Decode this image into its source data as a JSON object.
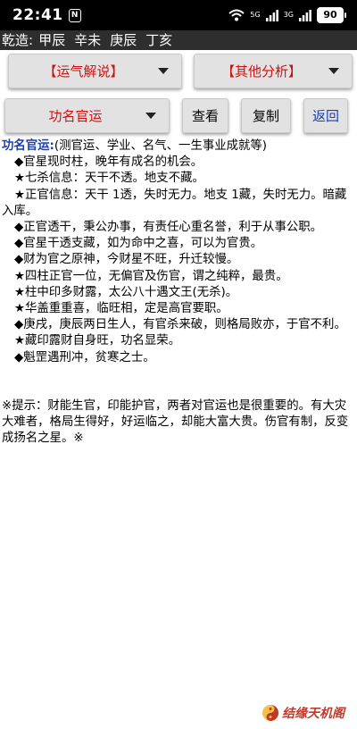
{
  "status_bar": {
    "time": "22:41",
    "n_badge": "N",
    "net_top": "5G",
    "net_bottom": "3G",
    "battery": "90"
  },
  "bazi": {
    "label": "乾造:",
    "pillars": [
      "甲辰",
      "辛未",
      "庚辰",
      "丁亥"
    ]
  },
  "controls": {
    "dropdown1": "【运气解说】",
    "dropdown2": "【其他分析】",
    "dropdown3": "功名官运",
    "view_button": "查看",
    "copy_button": "复制",
    "back_button": "返回"
  },
  "content": {
    "title": "功名官运:",
    "subtitle": "(测官运、学业、名气、一生事业成就等)",
    "lines": [
      "◆官星现时柱，晚年有成名的机会。",
      "★七杀信息：天干不透。地支不藏。",
      "★正官信息：天干 1透，失时无力。地支 1藏，失时无力。暗藏入库。",
      "◆正官透干，秉公办事，有责任心重名誉，利于从事公职。",
      "◆官星干透支藏，如为命中之喜，可以为官贵。",
      "◆财为官之原神，今财星不旺，升迁较慢。",
      "★四柱正官一位，无偏官及伤官，谓之纯粹，最贵。",
      "★柱中印多财露，太公八十遇文王(无杀)。",
      "★华盖重重喜，临旺相，定是高官要职。",
      "◆庚戌，庚辰两日生人，有官杀来破，则格局败亦，于官不利。",
      "★藏印露财自身旺，功名显荣。",
      "◆魁罡遇刑冲，贫寒之士。"
    ],
    "note": "※提示：财能生官，印能护官，两者对官运也是很重要的。有大灾大难者，格局生得好，好运临之，却能大富大贵。伤官有制，反变成扬名之星。※"
  },
  "watermark": {
    "text": "结缘天机阁"
  },
  "colors": {
    "accent_red": "#d01010",
    "accent_blue": "#1b3fb0",
    "button_bg": "#e2e2e2",
    "header_bg": "#2e2e2e"
  }
}
